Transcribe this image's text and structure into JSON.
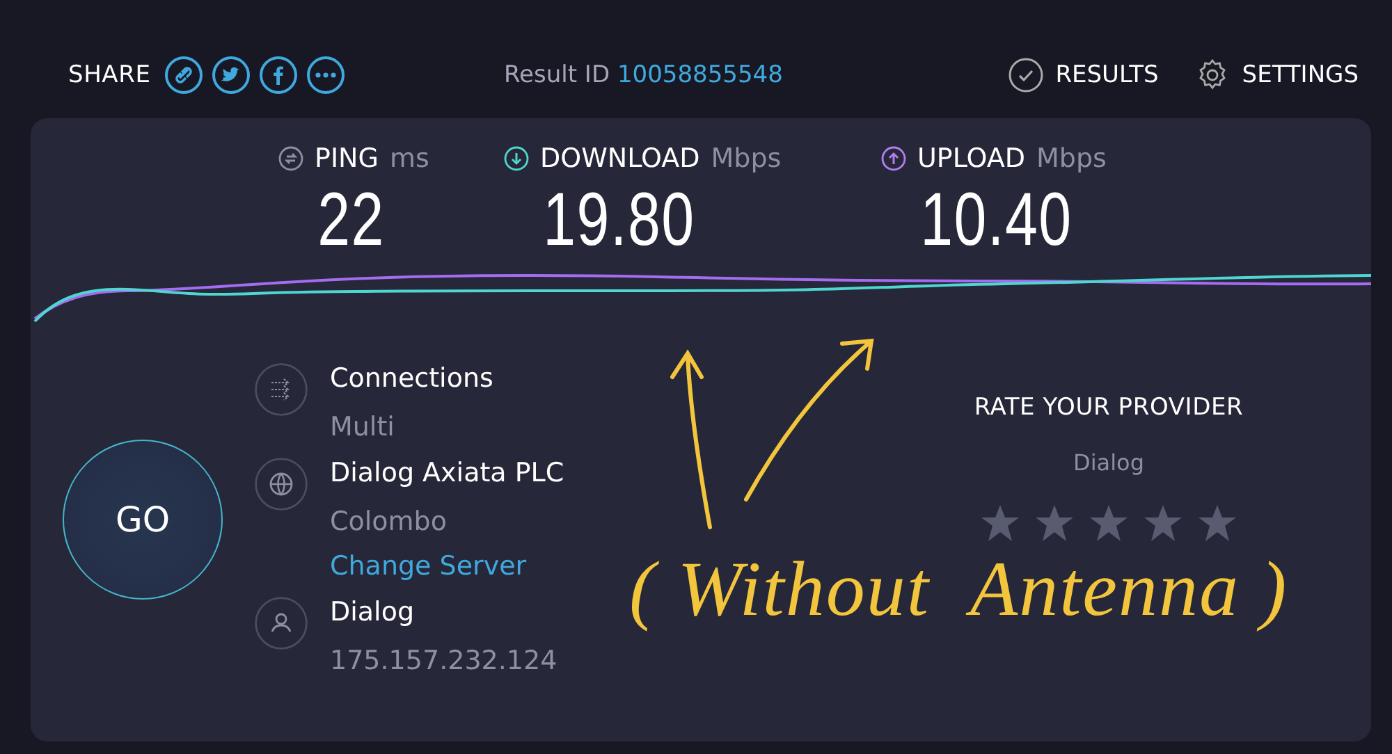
{
  "header": {
    "share_label": "SHARE",
    "result_id_label": "Result ID",
    "result_id": "10058855548",
    "nav": [
      {
        "kind": "results",
        "label": "RESULTS"
      },
      {
        "kind": "settings",
        "label": "SETTINGS"
      }
    ]
  },
  "metrics": [
    {
      "kind": "ping",
      "label": "PING",
      "unit": "ms",
      "value": "22"
    },
    {
      "kind": "download",
      "label": "DOWNLOAD",
      "unit": "Mbps",
      "value": "19.80"
    },
    {
      "kind": "upload",
      "label": "UPLOAD",
      "unit": "Mbps",
      "value": "10.40"
    }
  ],
  "go_button": "GO",
  "info": [
    {
      "kind": "connections",
      "title": "Connections",
      "subtitle": "Multi"
    },
    {
      "kind": "server",
      "title": "Dialog Axiata PLC",
      "subtitle": "Colombo",
      "link": "Change Server"
    },
    {
      "kind": "isp",
      "title": "Dialog",
      "subtitle": "175.157.232.124"
    }
  ],
  "rating": {
    "title": "RATE YOUR PROVIDER",
    "provider": "Dialog",
    "stars": 0
  },
  "annotation": {
    "text": "( Without  Antenna )"
  }
}
